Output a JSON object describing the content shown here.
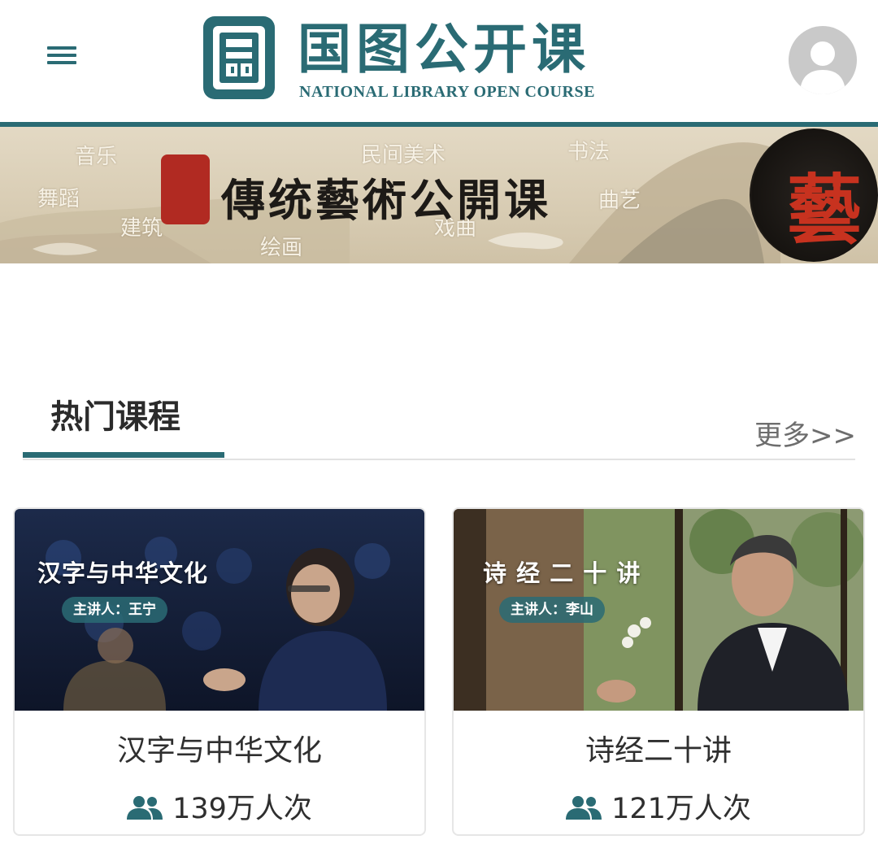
{
  "header": {
    "logo_title": "国图公开课",
    "logo_subtitle": "NATIONAL LIBRARY OPEN COURSE",
    "menu_icon": "hamburger-menu-icon",
    "avatar_icon": "user-avatar-icon"
  },
  "banner": {
    "title": "傳统藝術公開课",
    "words": [
      "音乐",
      "舞蹈",
      "建筑",
      "绘画",
      "民间美术",
      "戏曲",
      "书法",
      "曲艺"
    ],
    "ink_glyph": "藝"
  },
  "section": {
    "title": "热门课程",
    "more_label": "更多>>"
  },
  "courses": [
    {
      "overlay_title": "汉字与中华文化",
      "lecturer_chip": "主讲人：王宁",
      "name": "汉字与中华文化",
      "views": "139万人次"
    },
    {
      "overlay_title": "诗 经 二 十 讲",
      "lecturer_chip": "主讲人：李山",
      "name": "诗经二十讲",
      "views": "121万人次"
    }
  ],
  "colors": {
    "brand": "#2a6b74",
    "seal_red": "#b12a22"
  }
}
